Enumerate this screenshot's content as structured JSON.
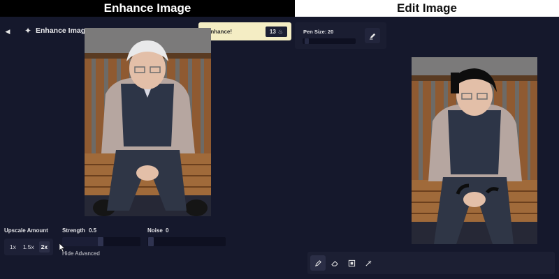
{
  "left": {
    "banner": "Enhance Image",
    "panel_title": "Enhance Image",
    "enhance_button": {
      "label": "Enhance!",
      "cost": "13",
      "cost_icon": "coin-icon"
    },
    "upscale": {
      "label": "Upscale Amount",
      "options": [
        "1x",
        "1.5x",
        "2x"
      ],
      "selected": "2x"
    },
    "strength": {
      "label": "Strength",
      "value": "0.5"
    },
    "noise": {
      "label": "Noise",
      "value": "0"
    },
    "hide_advanced": "Hide Advanced"
  },
  "right": {
    "banner": "Edit Image",
    "pen_size": {
      "label": "Pen Size:",
      "value": "20"
    },
    "tools": [
      "pencil-icon",
      "eraser-icon",
      "select-icon",
      "eyedropper-icon"
    ],
    "active_tool": "pencil-icon"
  },
  "colors": {
    "panel_bg": "#15182c",
    "accent_button": "#f4edc4"
  }
}
